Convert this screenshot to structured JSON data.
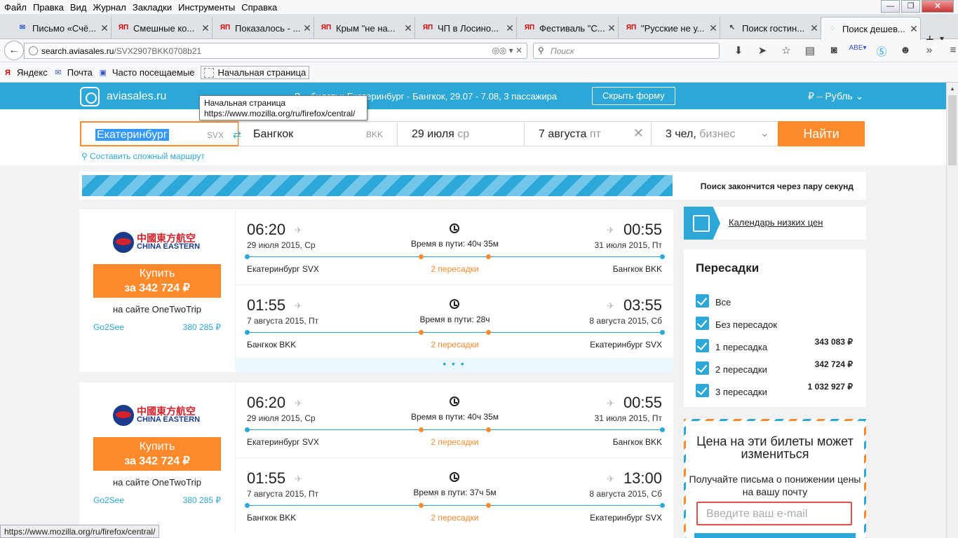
{
  "menu": [
    "Файл",
    "Правка",
    "Вид",
    "Журнал",
    "Закладки",
    "Инструменты",
    "Справка"
  ],
  "tabs": [
    {
      "icon": "mail-icon",
      "fav": "✉",
      "title": "Письмо «Счё..."
    },
    {
      "icon": "yap-icon",
      "fav": "ЯП",
      "title": "Смешные ко..."
    },
    {
      "icon": "yap-icon",
      "fav": "ЯП",
      "title": "Показалось - ..."
    },
    {
      "icon": "yap-icon",
      "fav": "ЯП",
      "title": "Крым \"не на..."
    },
    {
      "icon": "yap-icon",
      "fav": "ЯП",
      "title": "ЧП в Лосино..."
    },
    {
      "icon": "yap-icon",
      "fav": "ЯП",
      "title": "Фестиваль \"С..."
    },
    {
      "icon": "yap-icon",
      "fav": "ЯП",
      "title": "\"Русские не у..."
    },
    {
      "icon": "cursor-icon",
      "fav": "↖",
      "title": "Поиск гостин..."
    },
    {
      "icon": "loading-icon",
      "fav": "◌",
      "title": "Поиск дешев...",
      "active": true
    }
  ],
  "url": {
    "domain": "search.aviasales.ru",
    "path": "/SVX2907BKK0708b21"
  },
  "search": {
    "placeholder": "Поиск"
  },
  "bookmarks": [
    "Яндекс",
    "Почта",
    "Часто посещаемые",
    "Начальная страница"
  ],
  "tooltip": {
    "title": "Начальная страница",
    "url": "https://www.mozilla.org/ru/firefox/central/"
  },
  "site": {
    "logo": "aviasales.ru",
    "header_text": "В... билеты: Екатеринбург - Бангкок, 29.07 - 7.08, 3 пассажира",
    "hide_form": "Скрыть форму",
    "currency": "₽ – Рубль"
  },
  "form": {
    "from": "Екатеринбург",
    "from_code": "SVX",
    "to": "Бангкок",
    "to_code": "BKK",
    "date1": "29 июля",
    "date1_dow": "ср",
    "date2": "7 августа",
    "date2_dow": "пт",
    "pax": "3 чел,",
    "pax_class": "бизнес",
    "find": "Найти",
    "complex": "Составить сложный маршрут"
  },
  "progress": {
    "text": "Поиск закончится через пару секунд",
    "fraction": 0.75
  },
  "results": [
    {
      "airline_cn": "中國東方航空",
      "airline_en": "CHINA EASTERN",
      "buy": "Купить",
      "buy_price": "за 342 724 ₽",
      "onsite": "на сайте OneTwoTrip",
      "alt_agent": "Go2See",
      "alt_price": "380 285 ₽",
      "segments": [
        {
          "dep": "06:20",
          "arr": "00:55",
          "dep_date": "29 июля 2015, Ср",
          "arr_date": "31 июля 2015, Пт",
          "duration": "Время в пути: 40ч 35м",
          "from": "Екатеринбург SVX",
          "to": "Бангкок BKK",
          "stops": "2 пересадки"
        },
        {
          "dep": "01:55",
          "arr": "03:55",
          "dep_date": "7 августа 2015, Пт",
          "arr_date": "8 августа 2015, Сб",
          "duration": "Время в пути: 28ч",
          "from": "Бангкок BKK",
          "to": "Екатеринбург SVX",
          "stops": "2 пересадки"
        }
      ],
      "more": "• • •"
    },
    {
      "airline_cn": "中國東方航空",
      "airline_en": "CHINA EASTERN",
      "buy": "Купить",
      "buy_price": "за 342 724 ₽",
      "onsite": "на сайте OneTwoTrip",
      "alt_agent": "Go2See",
      "alt_price": "380 285 ₽",
      "segments": [
        {
          "dep": "06:20",
          "arr": "00:55",
          "dep_date": "29 июля 2015, Ср",
          "arr_date": "31 июля 2015, Пт",
          "duration": "Время в пути: 40ч 35м",
          "from": "Екатеринбург SVX",
          "to": "Бангкок BKK",
          "stops": "2 пересадки"
        },
        {
          "dep": "01:55",
          "arr": "13:00",
          "dep_date": "7 августа 2015, Пт",
          "arr_date": "8 августа 2015, Сб",
          "duration": "Время в пути: 37ч 5м",
          "from": "Бангкок BKK",
          "to": "Екатеринбург SVX",
          "stops": "2 пересадки"
        }
      ]
    }
  ],
  "calendar_link": "Календарь низких цен",
  "filters": {
    "title": "Пересадки",
    "items": [
      {
        "label": "Все",
        "price": "",
        "checked": true
      },
      {
        "label": "Без пересадок",
        "price": "",
        "checked": true
      },
      {
        "label": "1 пересадка",
        "price": "343 083 ₽",
        "checked": true
      },
      {
        "label": "2 пересадки",
        "price": "342 724 ₽",
        "checked": true
      },
      {
        "label": "3 пересадки",
        "price": "1 032 927 ₽",
        "checked": true
      }
    ]
  },
  "price_alert": {
    "heading": "Цена на эти билеты может измениться",
    "sub": "Получайте письма о понижении цены на вашу почту",
    "email_placeholder": "Введите ваш e-mail"
  },
  "status_url": "https://www.mozilla.org/ru/firefox/central/",
  "colors": {
    "accent": "#2ba7d8",
    "orange": "#ff8a2b"
  }
}
